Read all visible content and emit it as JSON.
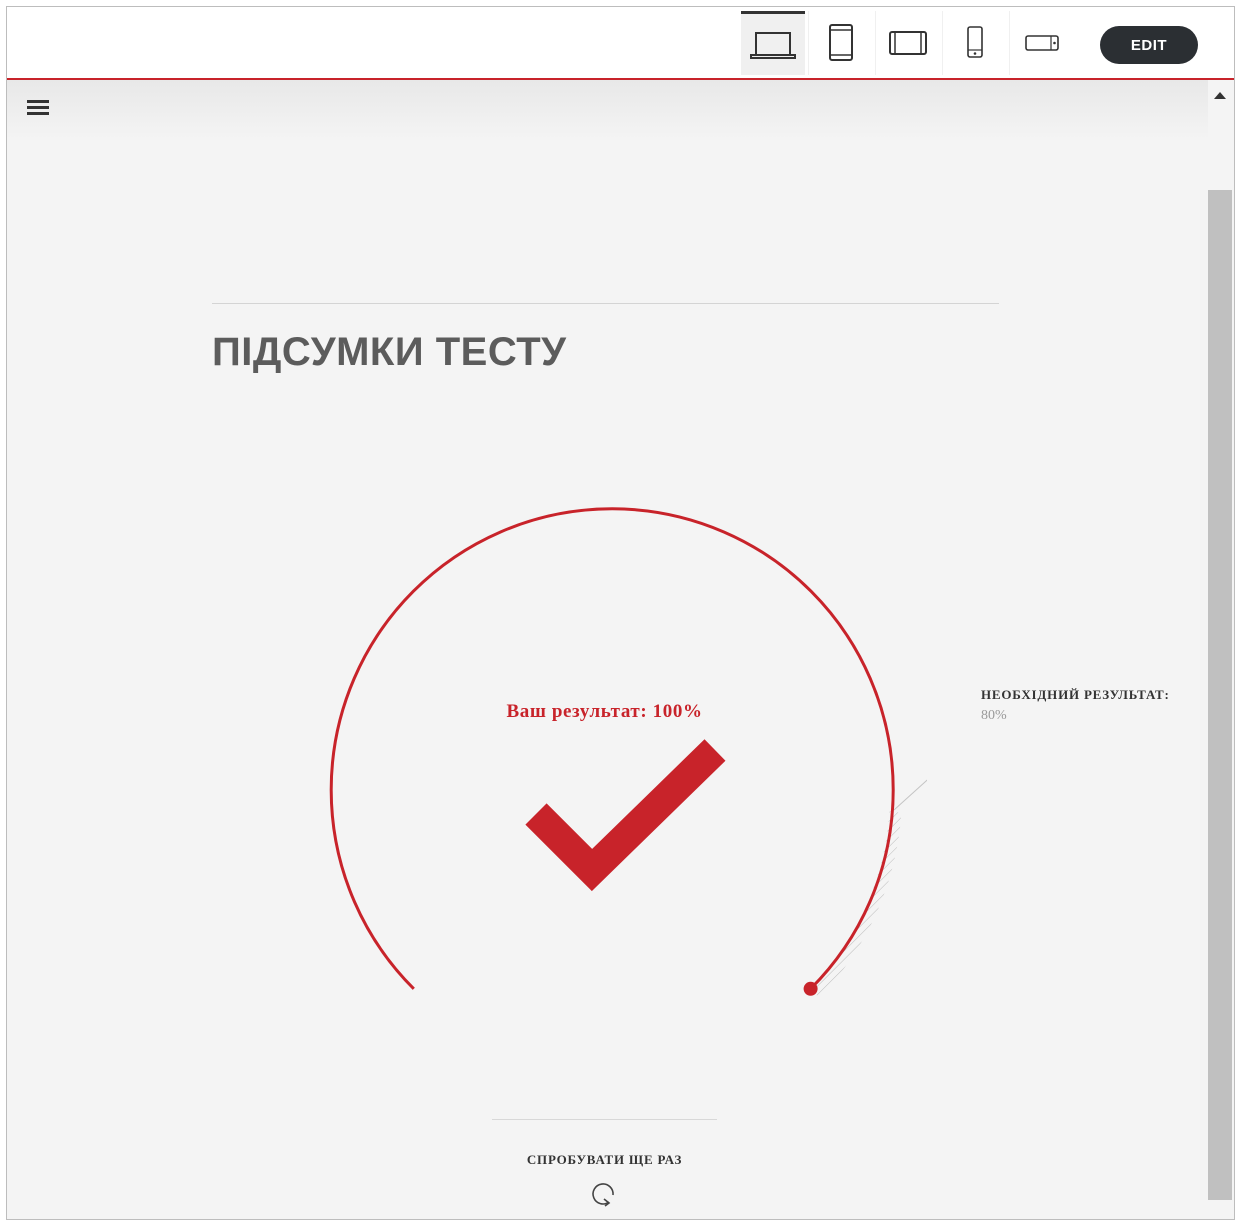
{
  "toolbar": {
    "devices": [
      {
        "name": "desktop",
        "icon": "laptop-icon",
        "active": true
      },
      {
        "name": "tablet-portrait",
        "icon": "tablet-portrait-icon",
        "active": false
      },
      {
        "name": "tablet-landscape",
        "icon": "tablet-landscape-icon",
        "active": false
      },
      {
        "name": "phone-portrait",
        "icon": "phone-portrait-icon",
        "active": false
      },
      {
        "name": "phone-landscape",
        "icon": "phone-landscape-icon",
        "active": false
      }
    ],
    "edit_label": "EDIT"
  },
  "content": {
    "menu_icon": "hamburger-menu-icon",
    "title": "ПІДСУМКИ ТЕСТУ",
    "score_label": "Ваш результат: 100%",
    "score_percent": 100,
    "required_label": "НЕОБХІДНИЙ РЕЗУЛЬТАТ:",
    "required_value": "80%",
    "required_percent": 80,
    "result_icon": "checkmark-icon",
    "retry_label": "СПРОБУВАТИ ЩЕ РАЗ",
    "retry_icon": "retry-icon"
  },
  "colors": {
    "accent": "#c8232a",
    "title": "#5c5c5c",
    "background": "#f4f4f4",
    "edit_button": "#2b2f33"
  }
}
